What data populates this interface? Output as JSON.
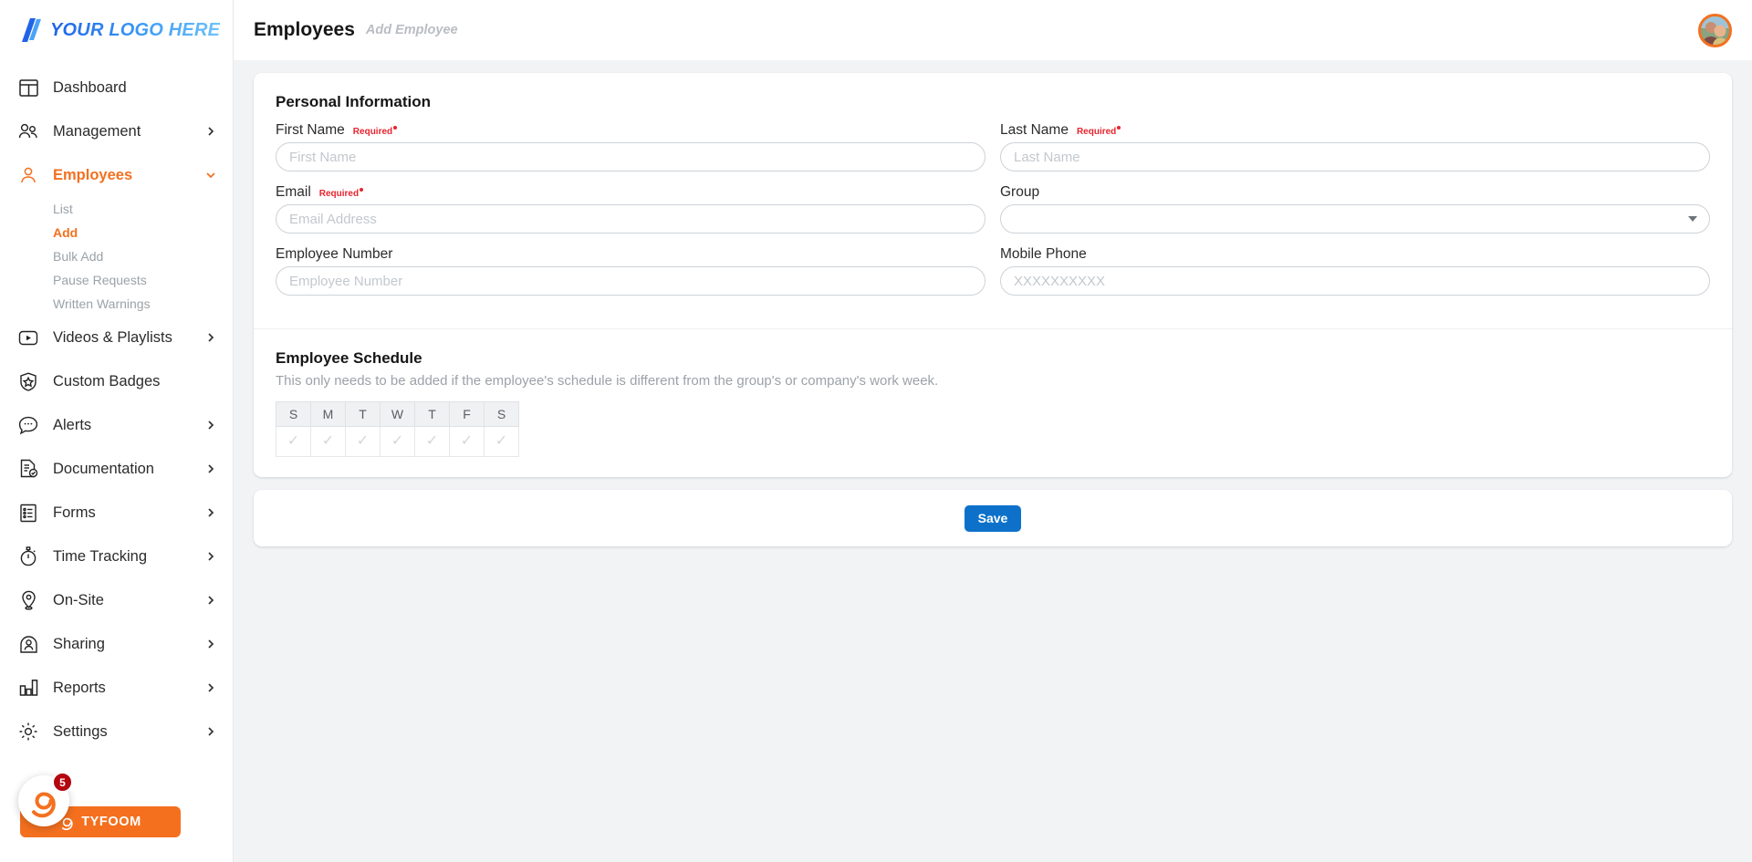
{
  "brand": {
    "logo_text": "YOUR LOGO HERE",
    "logo_icon": "slash-logo-icon",
    "accent_color": "#f4701f",
    "logo_color": "#2f86ef"
  },
  "sidebar": {
    "items": [
      {
        "label": "Dashboard",
        "icon": "dashboard-icon",
        "expandable": false,
        "active": false
      },
      {
        "label": "Management",
        "icon": "users-group-icon",
        "expandable": true,
        "active": false
      },
      {
        "label": "Employees",
        "icon": "user-icon",
        "expandable": true,
        "active": true,
        "subitems": [
          {
            "label": "List",
            "active": false
          },
          {
            "label": "Add",
            "active": true
          },
          {
            "label": "Bulk Add",
            "active": false
          },
          {
            "label": "Pause Requests",
            "active": false
          },
          {
            "label": "Written Warnings",
            "active": false
          }
        ]
      },
      {
        "label": "Videos & Playlists",
        "icon": "video-play-icon",
        "expandable": true,
        "active": false
      },
      {
        "label": "Custom Badges",
        "icon": "shield-star-icon",
        "expandable": false,
        "active": false
      },
      {
        "label": "Alerts",
        "icon": "chat-bubble-icon",
        "expandable": true,
        "active": false
      },
      {
        "label": "Documentation",
        "icon": "document-check-icon",
        "expandable": true,
        "active": false
      },
      {
        "label": "Forms",
        "icon": "form-list-icon",
        "expandable": true,
        "active": false
      },
      {
        "label": "Time Tracking",
        "icon": "stopwatch-icon",
        "expandable": true,
        "active": false
      },
      {
        "label": "On-Site",
        "icon": "map-pin-icon",
        "expandable": true,
        "active": false
      },
      {
        "label": "Sharing",
        "icon": "share-person-icon",
        "expandable": true,
        "active": false
      },
      {
        "label": "Reports",
        "icon": "bar-chart-icon",
        "expandable": true,
        "active": false
      },
      {
        "label": "Settings",
        "icon": "gear-icon",
        "expandable": true,
        "active": false
      }
    ],
    "tyfoom": {
      "label": "TYFOOM",
      "badge_count": "5",
      "badge_color": "#b3060f",
      "button_color": "#f4701f",
      "icon": "tyfoom-spiral-icon"
    }
  },
  "header": {
    "title": "Employees",
    "subtitle": "Add Employee",
    "avatar_icon": "user-avatar-photo"
  },
  "personal_information": {
    "section_title": "Personal Information",
    "required_text": "Required",
    "fields": [
      {
        "label": "First Name",
        "placeholder": "First Name",
        "value": "",
        "required": true,
        "type": "text"
      },
      {
        "label": "Last Name",
        "placeholder": "Last Name",
        "value": "",
        "required": true,
        "type": "text"
      },
      {
        "label": "Email",
        "placeholder": "Email Address",
        "value": "",
        "required": true,
        "type": "text"
      },
      {
        "label": "Group",
        "placeholder": "",
        "value": "",
        "required": false,
        "type": "select"
      },
      {
        "label": "Employee Number",
        "placeholder": "Employee Number",
        "value": "",
        "required": false,
        "type": "text"
      },
      {
        "label": "Mobile Phone",
        "placeholder": "XXXXXXXXXX",
        "value": "",
        "required": false,
        "type": "text"
      }
    ]
  },
  "employee_schedule": {
    "section_title": "Employee Schedule",
    "description": "This only needs to be added if the employee's schedule is different from the group's or company's work week.",
    "day_headers": [
      "S",
      "M",
      "T",
      "W",
      "T",
      "F",
      "S"
    ],
    "day_values": [
      "✓",
      "✓",
      "✓",
      "✓",
      "✓",
      "✓",
      "✓"
    ]
  },
  "footer": {
    "save_label": "Save",
    "save_color": "#0d71ca"
  }
}
